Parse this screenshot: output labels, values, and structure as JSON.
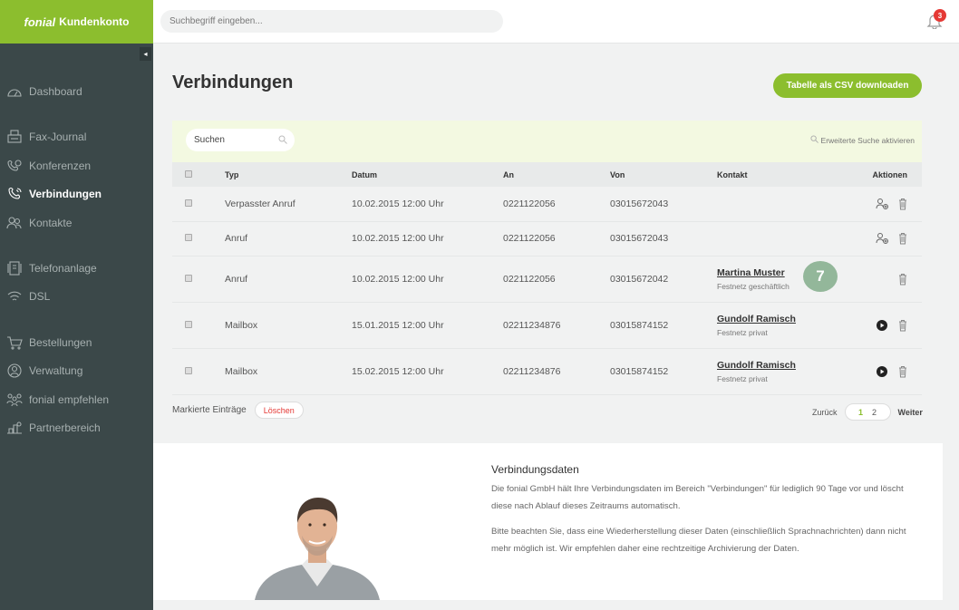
{
  "brand": {
    "logo": "fonial",
    "name": "Kundenkonto",
    "color": "#8cbe2e"
  },
  "topbar": {
    "search_placeholder": "Suchbegriff eingeben...",
    "notifications_count": "3"
  },
  "sidebar": {
    "collapse_glyph": "◂",
    "items": [
      {
        "label": "Dashboard",
        "icon": "dashboard-icon",
        "active": false
      },
      {
        "label": "Fax-Journal",
        "icon": "fax-icon",
        "active": false
      },
      {
        "label": "Konferenzen",
        "icon": "conference-icon",
        "active": false
      },
      {
        "label": "Verbindungen",
        "icon": "phone-icon",
        "active": true
      },
      {
        "label": "Kontakte",
        "icon": "contacts-icon",
        "active": false
      },
      {
        "label": "Telefonanlage",
        "icon": "pbx-icon",
        "active": false
      },
      {
        "label": "DSL",
        "icon": "wifi-icon",
        "active": false
      },
      {
        "label": "Bestellungen",
        "icon": "cart-icon",
        "active": false
      },
      {
        "label": "Verwaltung",
        "icon": "admin-icon",
        "active": false
      },
      {
        "label": "fonial empfehlen",
        "icon": "recommend-icon",
        "active": false
      },
      {
        "label": "Partnerbereich",
        "icon": "partner-icon",
        "active": false
      }
    ]
  },
  "main": {
    "title": "Verbindungen",
    "csv_button": "Tabelle als CSV downloaden",
    "table_search": "Suchen",
    "advanced_search": "Erweiterte Suche aktivieren",
    "columns": [
      "Typ",
      "Datum",
      "An",
      "Von",
      "Kontakt",
      "Aktionen"
    ],
    "rows": [
      {
        "typ": "Verpasster Anruf",
        "datum": "10.02.2015 12:00 Uhr",
        "an": "0221122056",
        "von": "03015672043",
        "kontakt": "",
        "kontakt_typ": "",
        "actions": [
          "add-contact-icon",
          "trash-icon"
        ]
      },
      {
        "typ": "Anruf",
        "datum": "10.02.2015 12:00 Uhr",
        "an": "0221122056",
        "von": "03015672043",
        "kontakt": "",
        "kontakt_typ": "",
        "actions": [
          "add-contact-icon",
          "trash-icon"
        ]
      },
      {
        "typ": "Anruf",
        "datum": "10.02.2015 12:00 Uhr",
        "an": "0221122056",
        "von": "03015672042",
        "kontakt": "Martina Muster",
        "kontakt_typ": "Festnetz geschäftlich",
        "actions": [
          "trash-icon"
        ]
      },
      {
        "typ": "Mailbox",
        "datum": "15.01.2015 12:00 Uhr",
        "an": "02211234876",
        "von": "03015874152",
        "kontakt": "Gundolf Ramisch",
        "kontakt_typ": "Festnetz privat",
        "actions": [
          "play-icon",
          "trash-icon"
        ]
      },
      {
        "typ": "Mailbox",
        "datum": "15.02.2015 12:00 Uhr",
        "an": "02211234876",
        "von": "03015874152",
        "kontakt": "Gundolf Ramisch",
        "kontakt_typ": "Festnetz privat",
        "actions": [
          "play-icon",
          "trash-icon"
        ]
      }
    ],
    "step_badge": "7",
    "bulk_label": "Markierte Einträge",
    "delete_button": "Löschen",
    "pager": {
      "prev": "Zurück",
      "pages": [
        "1",
        "2"
      ],
      "current": "1",
      "next": "Weiter"
    }
  },
  "info": {
    "title": "Verbindungsdaten",
    "p1": "Die fonial GmbH hält Ihre Verbindungsdaten im Bereich \"Verbindungen\" für lediglich 90 Tage vor und löscht diese nach Ablauf dieses Zeitraums automatisch.",
    "p2": "Bitte beachten Sie, dass eine Wiederherstellung dieser Daten (einschließlich Sprachnachrichten) dann nicht mehr möglich ist. Wir empfehlen daher eine rechtzeitige Archivierung der Daten."
  }
}
